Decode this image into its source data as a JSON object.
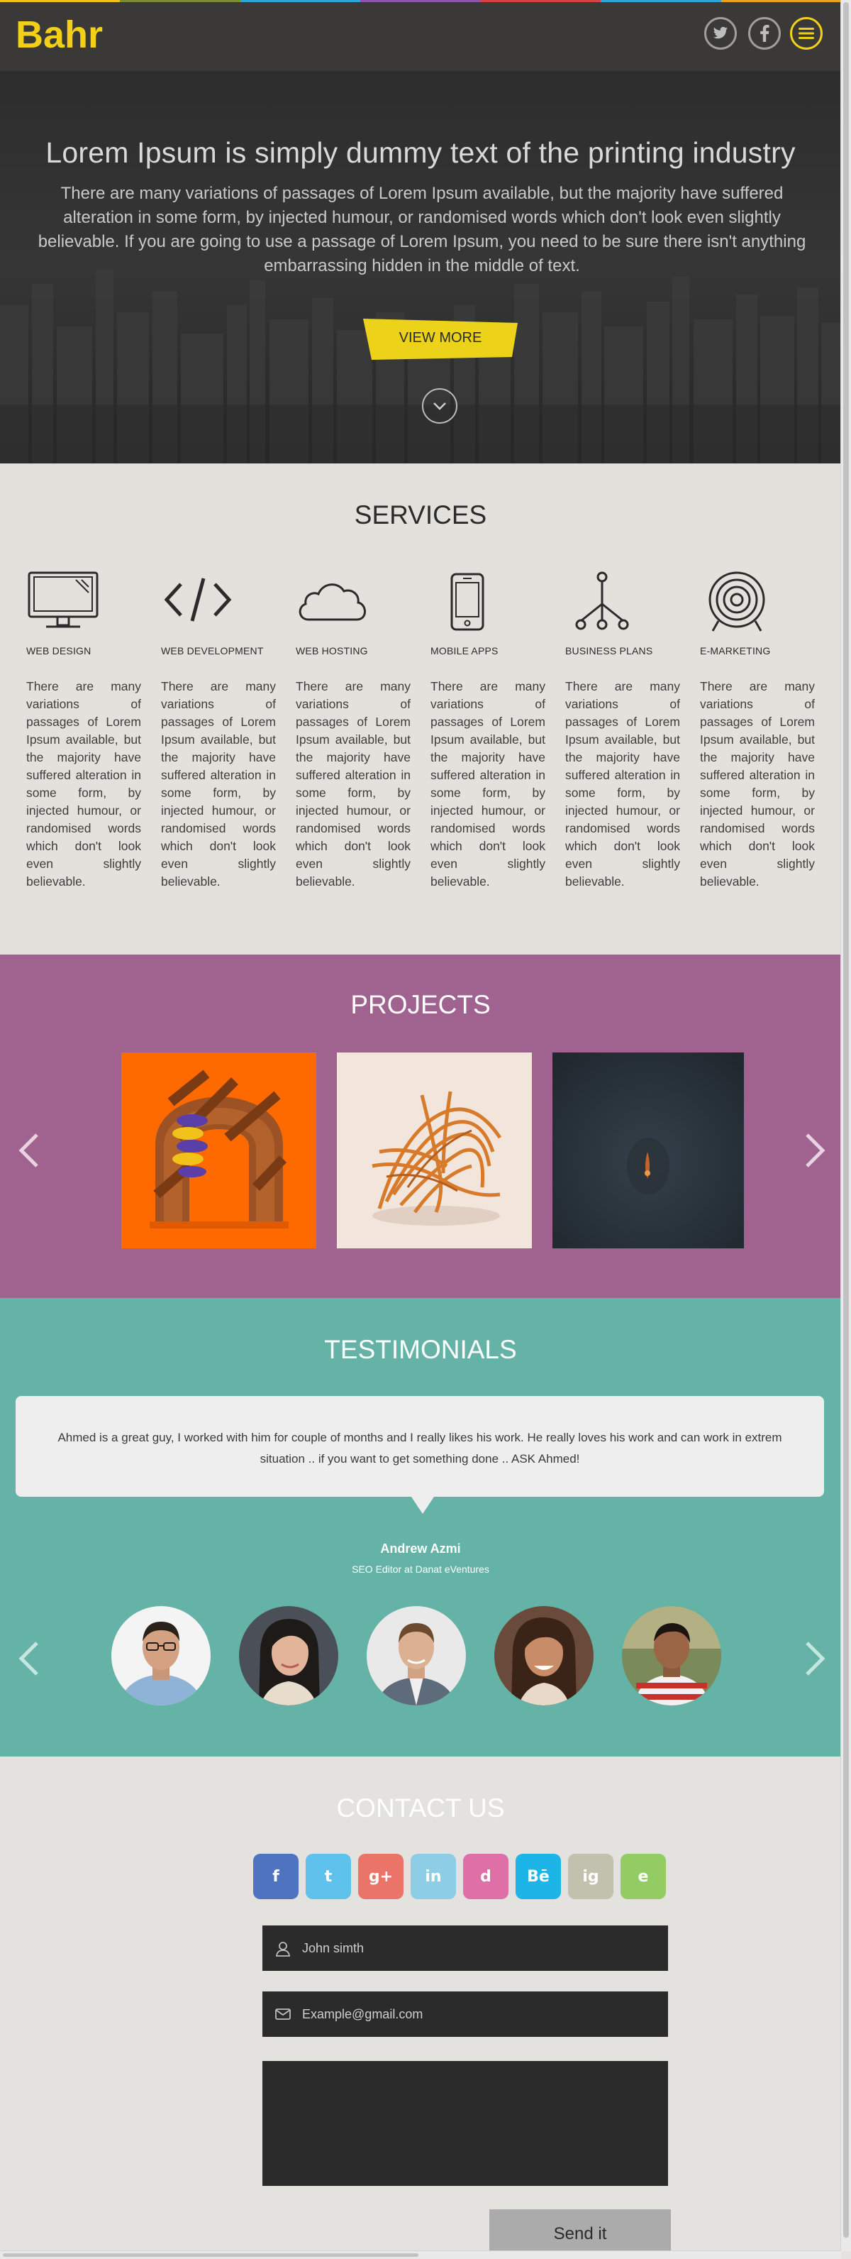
{
  "colors": {
    "accent_yellow": "#f2d01a",
    "header_bg": "#3a3938",
    "services_bg": "#e3e1dc",
    "projects_bg": "#a0628f",
    "testimonials_bg": "#64b3a6",
    "contact_bg": "#e3e2de",
    "strip": [
      "#e9c21c",
      "#7a8c3a",
      "#2aa6d9",
      "#8e55a5",
      "#d84142",
      "#2aa6d9",
      "#e9a21c"
    ]
  },
  "header": {
    "logo": "Bahr",
    "icons": [
      "twitter-icon",
      "facebook-icon",
      "menu-icon"
    ]
  },
  "hero": {
    "title": "Lorem Ipsum is simply dummy text of the printing industry",
    "text": "There are many variations of passages of Lorem Ipsum available, but the majority have suffered alteration in some form, by injected humour, or randomised words which don't look even slightly believable. If you are going to use a passage of Lorem Ipsum, you need to be sure there isn't anything embarrassing hidden in the middle of text.",
    "button": "VIEW MORE"
  },
  "services": {
    "title": "SERVICES",
    "items": [
      {
        "icon": "monitor-icon",
        "title": "WEB DESIGN",
        "text": "There are many variations of passages of Lorem Ipsum available, but the majority have suffered alteration in some form, by injected humour, or randomised words which don't look even slightly believable."
      },
      {
        "icon": "code-icon",
        "title": "WEB DEVELOPMENT",
        "text": "There are many variations of passages of Lorem Ipsum available, but the majority have suffered alteration in some form, by injected humour, or randomised words which don't look even slightly believable."
      },
      {
        "icon": "cloud-icon",
        "title": "WEB HOSTING",
        "text": "There are many variations of passages of Lorem Ipsum available, but the majority have suffered alteration in some form, by injected humour, or randomised words which don't look even slightly believable."
      },
      {
        "icon": "mobile-icon",
        "title": "MOBILE APPS",
        "text": "There are many variations of passages of Lorem Ipsum available, but the majority have suffered alteration in some form, by injected humour, or randomised words which don't look even slightly believable."
      },
      {
        "icon": "network-icon",
        "title": "BUSINESS PLANS",
        "text": "There are many variations of passages of Lorem Ipsum available, but the majority have suffered alteration in some form, by injected humour, or randomised words which don't look even slightly believable."
      },
      {
        "icon": "target-icon",
        "title": "E-MARKETING",
        "text": "There are many variations of passages of Lorem Ipsum available, but the majority have suffered alteration in some form, by injected humour, or randomised words which don't look even slightly believable."
      }
    ]
  },
  "projects": {
    "title": "PROJECTS"
  },
  "testimonials": {
    "title": "TESTIMONIALS",
    "quote": "Ahmed is a great guy, I worked with him for couple of months and I really likes his work. He really loves his work and can work in extrem situation .. if you want to get something done .. ASK Ahmed!",
    "name": "Andrew Azmi",
    "role": "SEO Editor at Danat eVentures"
  },
  "contact": {
    "title": "CONTACT US",
    "social": [
      {
        "icon": "facebook-icon",
        "glyph": "f",
        "color": "#4f73c0"
      },
      {
        "icon": "twitter-icon",
        "glyph": "t",
        "color": "#5ec2ec"
      },
      {
        "icon": "google-plus-icon",
        "glyph": "g+",
        "color": "#ea7467"
      },
      {
        "icon": "linkedin-icon",
        "glyph": "in",
        "color": "#8ecde6"
      },
      {
        "icon": "dribbble-icon",
        "glyph": "d",
        "color": "#df6fa7"
      },
      {
        "icon": "behance-icon",
        "glyph": "Bē",
        "color": "#1db4e8"
      },
      {
        "icon": "instagram-icon",
        "glyph": "ig",
        "color": "#c2c1ae"
      },
      {
        "icon": "evernote-icon",
        "glyph": "e",
        "color": "#93cc63"
      }
    ],
    "name_placeholder": "John simth",
    "email_placeholder": "Example@gmail.com",
    "send": "Send it"
  }
}
